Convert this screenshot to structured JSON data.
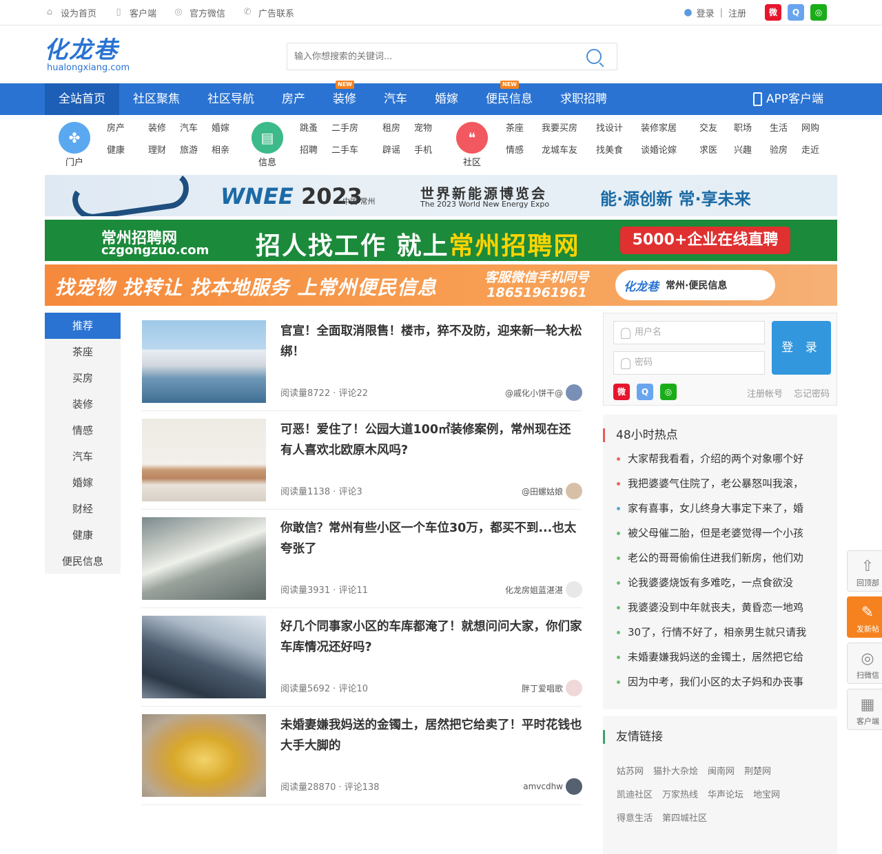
{
  "topbar": {
    "links": [
      {
        "icon": "home-icon",
        "label": "设为首页"
      },
      {
        "icon": "phone-icon",
        "label": "客户端"
      },
      {
        "icon": "wechat-icon",
        "label": "官方微信"
      },
      {
        "icon": "call-icon",
        "label": "广告联系"
      }
    ],
    "login": "登录",
    "register": "注册",
    "sep": "|"
  },
  "logo": {
    "cn": "化龙巷",
    "en": "hualongxiang.com"
  },
  "search": {
    "placeholder": "输入你想搜索的关键词..."
  },
  "nav": {
    "items": [
      {
        "label": "全站首页",
        "active": true,
        "badge": ""
      },
      {
        "label": "社区聚焦",
        "badge": ""
      },
      {
        "label": "社区导航",
        "badge": ""
      },
      {
        "label": "房产",
        "badge": ""
      },
      {
        "label": "装修",
        "badge": "NEW"
      },
      {
        "label": "汽车",
        "badge": ""
      },
      {
        "label": "婚嫁",
        "badge": ""
      },
      {
        "label": "便民信息",
        "badge": "NEW"
      },
      {
        "label": "求职招聘",
        "badge": ""
      }
    ],
    "app": "APP客户端"
  },
  "subnav": [
    {
      "name": "门户",
      "color": "#5aa8f0",
      "icon": "grid-icon",
      "links": [
        "房产",
        "装修",
        "汽车",
        "婚嫁",
        "健康",
        "理财",
        "旅游",
        "相亲"
      ],
      "cols": 4
    },
    {
      "name": "信息",
      "color": "#3dba8a",
      "icon": "message-icon",
      "links": [
        "跳蚤",
        "二手房",
        "租房",
        "宠物",
        "招聘",
        "二手车",
        "辟谣",
        "手机"
      ],
      "cols": 4
    },
    {
      "name": "社区",
      "color": "#f2585f",
      "icon": "chat-icon",
      "links": [
        "茶座",
        "我要买房",
        "找设计",
        "装修家居",
        "交友",
        "职场",
        "生活",
        "网购",
        "情感",
        "龙城车友",
        "找美食",
        "谈婚论嫁",
        "求医",
        "兴趣",
        "验房",
        "走近"
      ],
      "cols": 8
    }
  ],
  "banners": {
    "b1": {
      "brand": "WNEE",
      "year": "2023",
      "city": "中国·常州",
      "title": "世界新能源博览会",
      "subtitle": "The 2023 World New Energy Expo",
      "slogan": "能·源创新 常·享未来"
    },
    "b2": {
      "name": "常州招聘网",
      "domain": "czgongzuo.com",
      "slogan_a": "招人找工作 就上",
      "slogan_b": "常州招聘网",
      "badge": "5000+企业在线直聘"
    },
    "b3": {
      "slogan": "找宠物 找转让 找本地服务 上常州便民信息",
      "service_a": "客服微信手机同号",
      "service_b": "18651961961",
      "tag_logo": "化龙巷",
      "tag_text": "常州·便民信息"
    }
  },
  "sidebar": [
    "推荐",
    "茶座",
    "买房",
    "装修",
    "情感",
    "汽车",
    "婚嫁",
    "财经",
    "健康",
    "便民信息"
  ],
  "articles": [
    {
      "title": "官宣！全面取消限售！楼市，猝不及防，迎来新一轮大松绑！",
      "meta": "阅读量8722 · 评论22",
      "author": "@戚化小饼干@",
      "img": "city",
      "avatar": "#7a8fb5"
    },
    {
      "title": "可恶！爱住了！公园大道100㎡装修案例，常州现在还有人喜欢北欧原木风吗?",
      "meta": "阅读量1138 · 评论3",
      "author": "@田螺姑娘",
      "img": "room",
      "avatar": "#d8c0a8"
    },
    {
      "title": "你敢信？常州有些小区一个车位30万，都买不到...也太夸张了",
      "meta": "阅读量3931 · 评论11",
      "author": "化龙房姐蓝湛湛",
      "img": "garage",
      "avatar": "#e8e8e8"
    },
    {
      "title": "好几个同事家小区的车库都淹了！就想问问大家，你们家车库情况还好吗?",
      "meta": "阅读量5692 · 评论10",
      "author": "胖丁爱唱歌",
      "img": "tower",
      "avatar": "#f0d8d8"
    },
    {
      "title": "未婚妻嫌我妈送的金镯土，居然把它给卖了！平时花钱也大手大脚的",
      "meta": "阅读量28870 · 评论138",
      "author": "amvcdhw",
      "img": "gold",
      "avatar": "#556070"
    }
  ],
  "login_box": {
    "user_placeholder": "用户名",
    "pass_placeholder": "密码",
    "button": "登 录",
    "register": "注册帐号",
    "forgot": "忘记密码"
  },
  "hot": {
    "title": "48小时热点",
    "items": [
      "大家帮我看看，介绍的两个对象哪个好",
      "我把婆婆气住院了，老公暴怒叫我滚，",
      "家有喜事，女儿终身大事定下来了，婚",
      "被父母催二胎，但是老婆觉得一个小孩",
      "老公的哥哥偷偷住进我们新房，他们劝",
      "论我婆婆烧饭有多难吃，一点食欲没",
      "我婆婆没到中年就丧夫，黄昏恋一地鸡",
      "30了，行情不好了，相亲男生就只请我",
      "未婚妻嫌我妈送的金镯土，居然把它给",
      "因为中考，我们小区的太子妈和办丧事"
    ]
  },
  "friends": {
    "title": "友情链接",
    "links": [
      "姑苏网",
      "猫扑大杂烩",
      "闽南网",
      "荆楚网",
      "凯迪社区",
      "万家热线",
      "华声论坛",
      "地宝网",
      "得意生活",
      "第四城社区"
    ]
  },
  "floats": [
    {
      "label": "回顶部",
      "icon": "arrow-up-icon"
    },
    {
      "label": "发新帖",
      "icon": "pencil-icon"
    },
    {
      "label": "扫微信",
      "icon": "wechat-icon"
    },
    {
      "label": "客户端",
      "icon": "qrcode-icon"
    }
  ],
  "colors": {
    "brand": "#2a73d2",
    "nav_active": "#1d5fb6",
    "badge": "#f5821f",
    "login_btn": "#3397dd"
  }
}
